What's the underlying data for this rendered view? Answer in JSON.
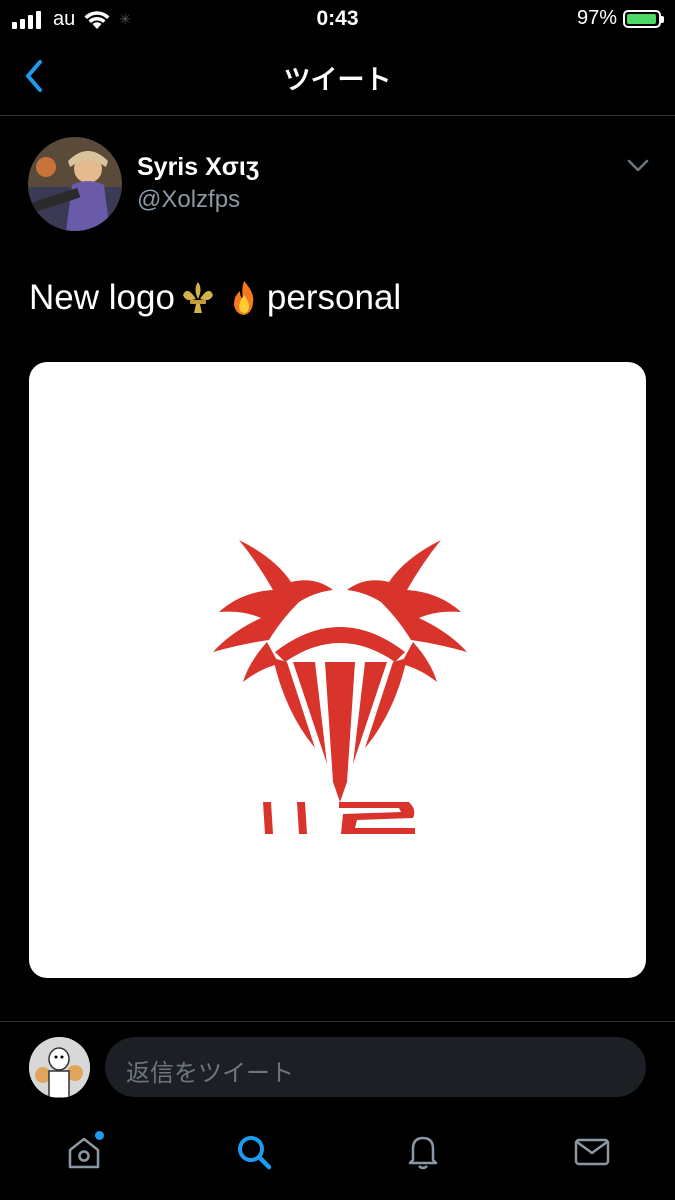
{
  "status_bar": {
    "carrier": "au",
    "time": "0:43",
    "battery_percent": "97%",
    "battery_level": 0.97,
    "battery_color": "#4cd964"
  },
  "nav": {
    "title": "ツイート",
    "back_icon": "chevron-left-icon"
  },
  "tweet": {
    "display_name": "Syris Xσιʒ",
    "handle": "@Xolzfps",
    "text_before": "New logo",
    "emojis": [
      "fleur-de-lis-emoji",
      "fire-emoji"
    ],
    "text_after": "personal",
    "media": {
      "logo_caption": "112",
      "logo_color": "#d9342b"
    }
  },
  "reply": {
    "placeholder": "返信をツイート"
  },
  "tab_bar": {
    "items": [
      "home-icon",
      "search-icon",
      "notifications-icon",
      "messages-icon"
    ],
    "active": "search-icon",
    "accent": "#1d9bf0"
  }
}
